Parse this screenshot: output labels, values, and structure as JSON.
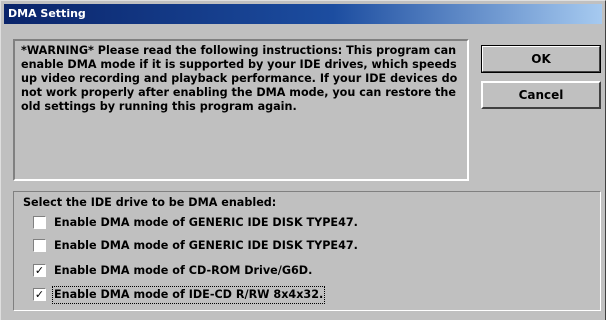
{
  "window": {
    "title": "DMA Setting"
  },
  "warning": {
    "text": "*WARNING* Please read the following instructions: This program can enable DMA mode if it is supported by your IDE drives, which speeds up video recording and playback performance. If your IDE devices do not work properly after enabling the DMA mode, you can restore the old settings by running this program again."
  },
  "buttons": {
    "ok_label": "OK",
    "cancel_label": "Cancel"
  },
  "drives": {
    "group_label": "Select the IDE drive to be DMA enabled:",
    "items": [
      {
        "label": "Enable DMA mode of GENERIC IDE  DISK TYPE47.",
        "checked": false,
        "mark": ""
      },
      {
        "label": "Enable DMA mode of GENERIC IDE  DISK TYPE47.",
        "checked": false,
        "mark": ""
      },
      {
        "label": "Enable DMA mode of CD-ROM Drive/G6D.",
        "checked": true,
        "mark": "✓"
      },
      {
        "label": "Enable DMA mode of IDE-CD R/RW 8x4x32.",
        "checked": true,
        "mark": "✓"
      }
    ]
  },
  "colors": {
    "face": "#c0c0c0",
    "titlebar": "#0a246a"
  }
}
